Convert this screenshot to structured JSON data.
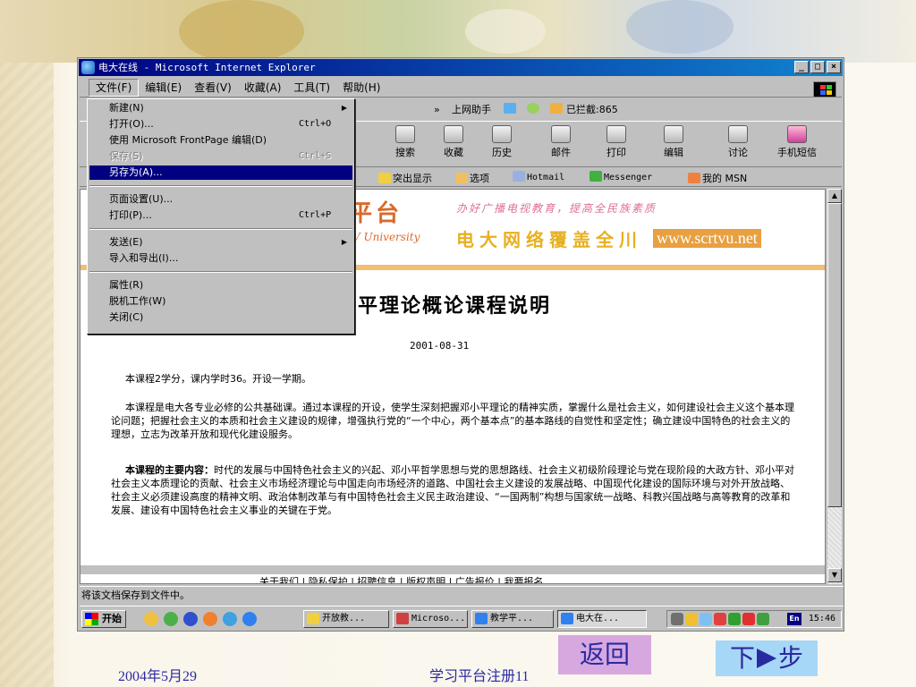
{
  "window": {
    "title": "电大在线 - Microsoft Internet Explorer",
    "buttons": [
      "_",
      "□",
      "×"
    ]
  },
  "menubar": [
    "文件(F)",
    "编辑(E)",
    "查看(V)",
    "收藏(A)",
    "工具(T)",
    "帮助(H)"
  ],
  "toolbar_row1": {
    "chevron": "»",
    "items": [
      "上网助手",
      "已拦截:865"
    ]
  },
  "toolbar_buttons": [
    "搜索",
    "收藏",
    "历史",
    "邮件",
    "打印",
    "编辑",
    "讨论",
    "手机短信"
  ],
  "links_bar": [
    "突出显示",
    "选项",
    "Hotmail",
    "Messenger",
    "我的 MSN"
  ],
  "file_menu": {
    "items": [
      {
        "label": "新建(N)",
        "shortcut": "",
        "submenu": true,
        "state": "normal"
      },
      {
        "label": "打开(O)...",
        "shortcut": "Ctrl+O",
        "submenu": false,
        "state": "normal"
      },
      {
        "label": "使用 Microsoft FrontPage 编辑(D)",
        "shortcut": "",
        "submenu": false,
        "state": "normal"
      },
      {
        "label": "保存(S)",
        "shortcut": "Ctrl+S",
        "submenu": false,
        "state": "disabled"
      },
      {
        "label": "另存为(A)...",
        "shortcut": "",
        "submenu": false,
        "state": "highlighted"
      },
      {
        "label": "页面设置(U)...",
        "shortcut": "",
        "submenu": false,
        "state": "normal"
      },
      {
        "label": "打印(P)...",
        "shortcut": "Ctrl+P",
        "submenu": false,
        "state": "normal"
      },
      {
        "label": "发送(E)",
        "shortcut": "",
        "submenu": true,
        "state": "normal"
      },
      {
        "label": "导入和导出(I)...",
        "shortcut": "",
        "submenu": false,
        "state": "normal"
      },
      {
        "label": "属性(R)",
        "shortcut": "",
        "submenu": false,
        "state": "normal"
      },
      {
        "label": "脱机工作(W)",
        "shortcut": "",
        "submenu": false,
        "state": "normal"
      },
      {
        "label": "关闭(C)",
        "shortcut": "",
        "submenu": false,
        "state": "normal"
      }
    ]
  },
  "banner": {
    "title": "平台",
    "subtitle": "TV University",
    "slogan": "办好广播电视教育，提高全民族素质",
    "big": "电大网络覆盖全川",
    "url": "www.scrtvu.net"
  },
  "page": {
    "title": "平理论概论课程说明",
    "date": "2001-08-31",
    "p1": "本课程2学分，课内学时36。开设一学期。",
    "p2": "本课程是电大各专业必修的公共基础课。通过本课程的开设，使学生深刻把握邓小平理论的精神实质，掌握什么是社会主义，如何建设社会主义这个基本理论问题；把握社会主义的本质和社会主义建设的规律，增强执行党的“一个中心，两个基本点”的基本路线的自觉性和坚定性；确立建设中国特色的社会主义的理想，立志为改革开放和现代化建设服务。",
    "p3_lead": "本课程的主要内容：",
    "p3": "时代的发展与中国特色社会主义的兴起、邓小平哲学思想与党的思想路线、社会主义初级阶段理论与党在现阶段的大政方针、邓小平对社会主义本质理论的贡献、社会主义市场经济理论与中国走向市场经济的道路、中国社会主义建设的发展战略、中国现代化建设的国际环境与对外开放战略、社会主义必须建设高度的精神文明、政治体制改革与有中国特色社会主义民主政治建设、“一国两制”构想与国家统一战略、科教兴国战略与高等教育的改革和发展、建设有中国特色社会主义事业的关键在于党。",
    "footer_links": "关于我们 | 隐私保护 | 招聘信息 | 版权声明 | 广告报价 | 我要报名"
  },
  "statusbar": "将该文档保存到文件中。",
  "taskbar": {
    "start": "开始",
    "tasks": [
      "开放教...",
      "Microso...",
      "教学平...",
      "电大在..."
    ],
    "lang": "En",
    "clock": "15:46"
  },
  "slide": {
    "date": "2004年5月29",
    "footer_center": "学习平台注册11",
    "back": "返回",
    "next_left": "下",
    "next_right": "步"
  }
}
